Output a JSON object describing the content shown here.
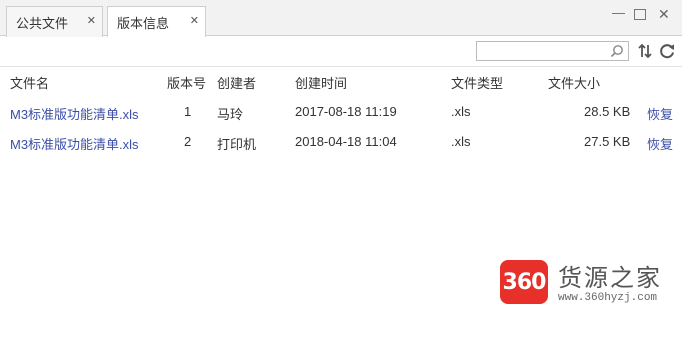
{
  "tabs": [
    {
      "label": "公共文件",
      "active": false
    },
    {
      "label": "版本信息",
      "active": true
    }
  ],
  "window_controls": {
    "minimize": "—",
    "maximize": "□",
    "close": "✕"
  },
  "toolbar": {
    "search_placeholder": "",
    "search_value": ""
  },
  "columns": [
    "文件名",
    "版本号",
    "创建者",
    "创建时间",
    "文件类型",
    "文件大小"
  ],
  "rows": [
    {
      "name": "M3标准版功能清单.xls",
      "version": "1",
      "creator": "马玲",
      "created": "2017-08-18 11:19",
      "type": ".xls",
      "size": "28.5 KB",
      "action": "恢复"
    },
    {
      "name": "M3标准版功能清单.xls",
      "version": "2",
      "creator": "打印机",
      "created": "2018-04-18 11:04",
      "type": ".xls",
      "size": "27.5 KB",
      "action": "恢复"
    }
  ],
  "watermark": {
    "badge": "360",
    "title": "货源之家",
    "url": "www.360hyzj.com"
  },
  "colors": {
    "link": "#3b4fa8",
    "badge": "#e8302a"
  }
}
